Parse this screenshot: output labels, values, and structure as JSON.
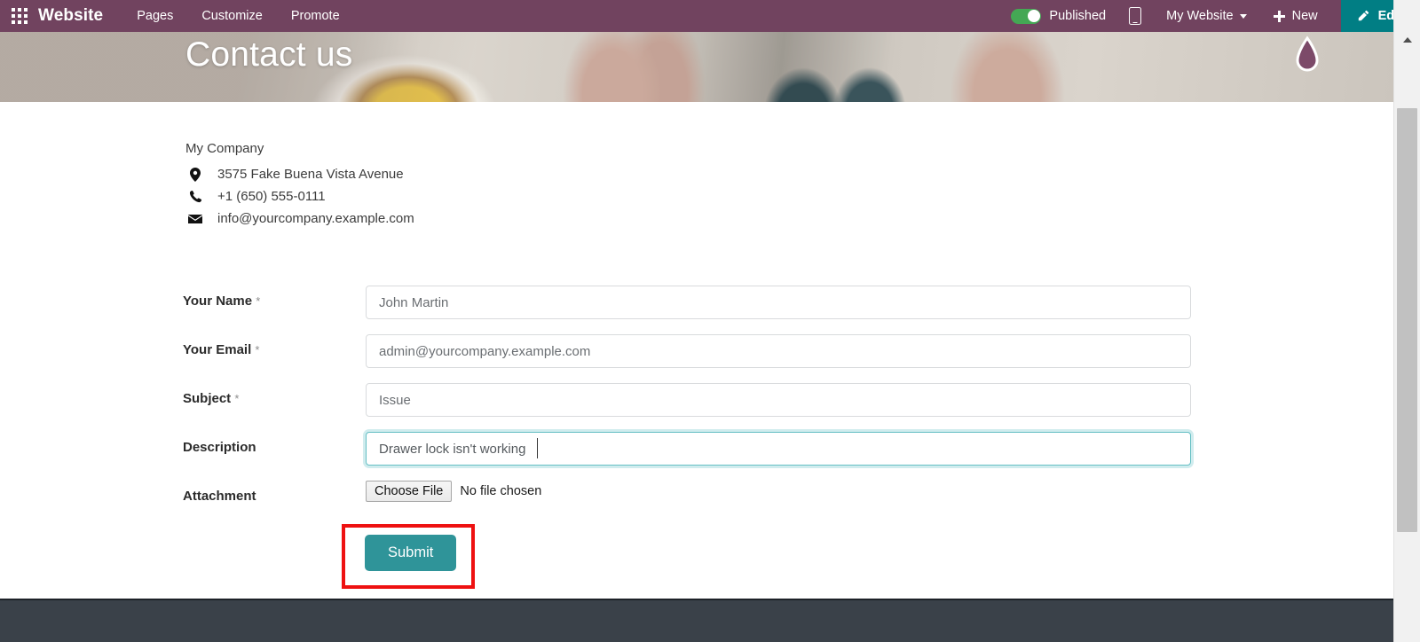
{
  "topbar": {
    "apps_icon": "apps-grid-icon",
    "brand": "Website",
    "menu": [
      "Pages",
      "Customize",
      "Promote"
    ],
    "published_label": "Published",
    "published_state": "on",
    "mobile_icon": "mobile-preview-icon",
    "site_selector": "My Website",
    "new_label": "New",
    "edit_label": "Edit",
    "colors": {
      "bar_bg": "#71435f",
      "edit_bg": "#017e84",
      "toggle_on": "#44a854"
    }
  },
  "hero": {
    "title": "Contact us",
    "logo_icon": "water-drop-logo-icon"
  },
  "company": {
    "name": "My Company",
    "address": "3575 Fake Buena Vista Avenue",
    "phone": "+1 (650) 555-0111",
    "email": "info@yourcompany.example.com",
    "address_icon": "map-pin-icon",
    "phone_icon": "phone-icon",
    "email_icon": "envelope-icon"
  },
  "form": {
    "fields": [
      {
        "label": "Your Name",
        "required": "*",
        "value": "John Martin",
        "placeholder": "Your Name",
        "focused": false
      },
      {
        "label": "Your Email",
        "required": "*",
        "value": "admin@yourcompany.example.com",
        "placeholder": "Your Email",
        "focused": false
      },
      {
        "label": "Subject",
        "required": "*",
        "value": "Issue",
        "placeholder": "Subject",
        "focused": false
      },
      {
        "label": "Description",
        "required": "",
        "value": "Drawer lock isn't working",
        "placeholder": "Description",
        "focused": true
      }
    ],
    "attachment": {
      "label": "Attachment",
      "button_label": "Choose File",
      "status": "No file chosen"
    },
    "submit_label": "Submit",
    "submit_color": "#2f9499",
    "highlight_color": "#ee1111"
  }
}
